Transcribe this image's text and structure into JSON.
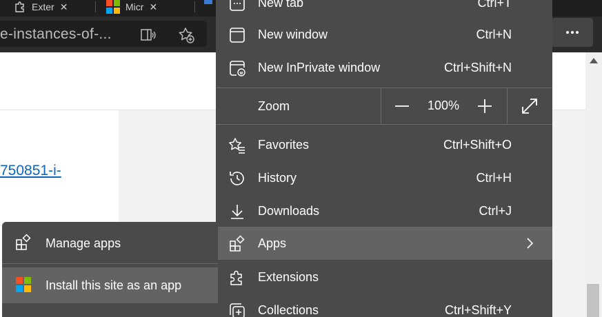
{
  "tabs": [
    {
      "label": "Exter"
    },
    {
      "label": "Micr"
    }
  ],
  "addressbar": {
    "url_fragment": "e-instances-of-..."
  },
  "page": {
    "link_text": "750851-i-"
  },
  "menu": {
    "new_tab": {
      "label": "New tab",
      "shortcut": "Ctrl+T"
    },
    "new_window": {
      "label": "New window",
      "shortcut": "Ctrl+N"
    },
    "new_inprivate": {
      "label": "New InPrivate window",
      "shortcut": "Ctrl+Shift+N"
    },
    "zoom": {
      "label": "Zoom",
      "value": "100%"
    },
    "favorites": {
      "label": "Favorites",
      "shortcut": "Ctrl+Shift+O"
    },
    "history": {
      "label": "History",
      "shortcut": "Ctrl+H"
    },
    "downloads": {
      "label": "Downloads",
      "shortcut": "Ctrl+J"
    },
    "apps": {
      "label": "Apps"
    },
    "extensions": {
      "label": "Extensions"
    },
    "collections": {
      "label": "Collections",
      "shortcut": "Ctrl+Shift+Y"
    }
  },
  "apps_submenu": {
    "manage_apps": {
      "label": "Manage apps"
    },
    "install_site": {
      "label": "Install this site as an app"
    }
  },
  "colors": {
    "menu_bg": "#4a4a4a",
    "menu_highlight": "#636363",
    "link": "#0b65c2",
    "ms_red": "#f25022",
    "ms_green": "#7fba00",
    "ms_blue": "#00a4ef",
    "ms_yellow": "#ffb900"
  }
}
